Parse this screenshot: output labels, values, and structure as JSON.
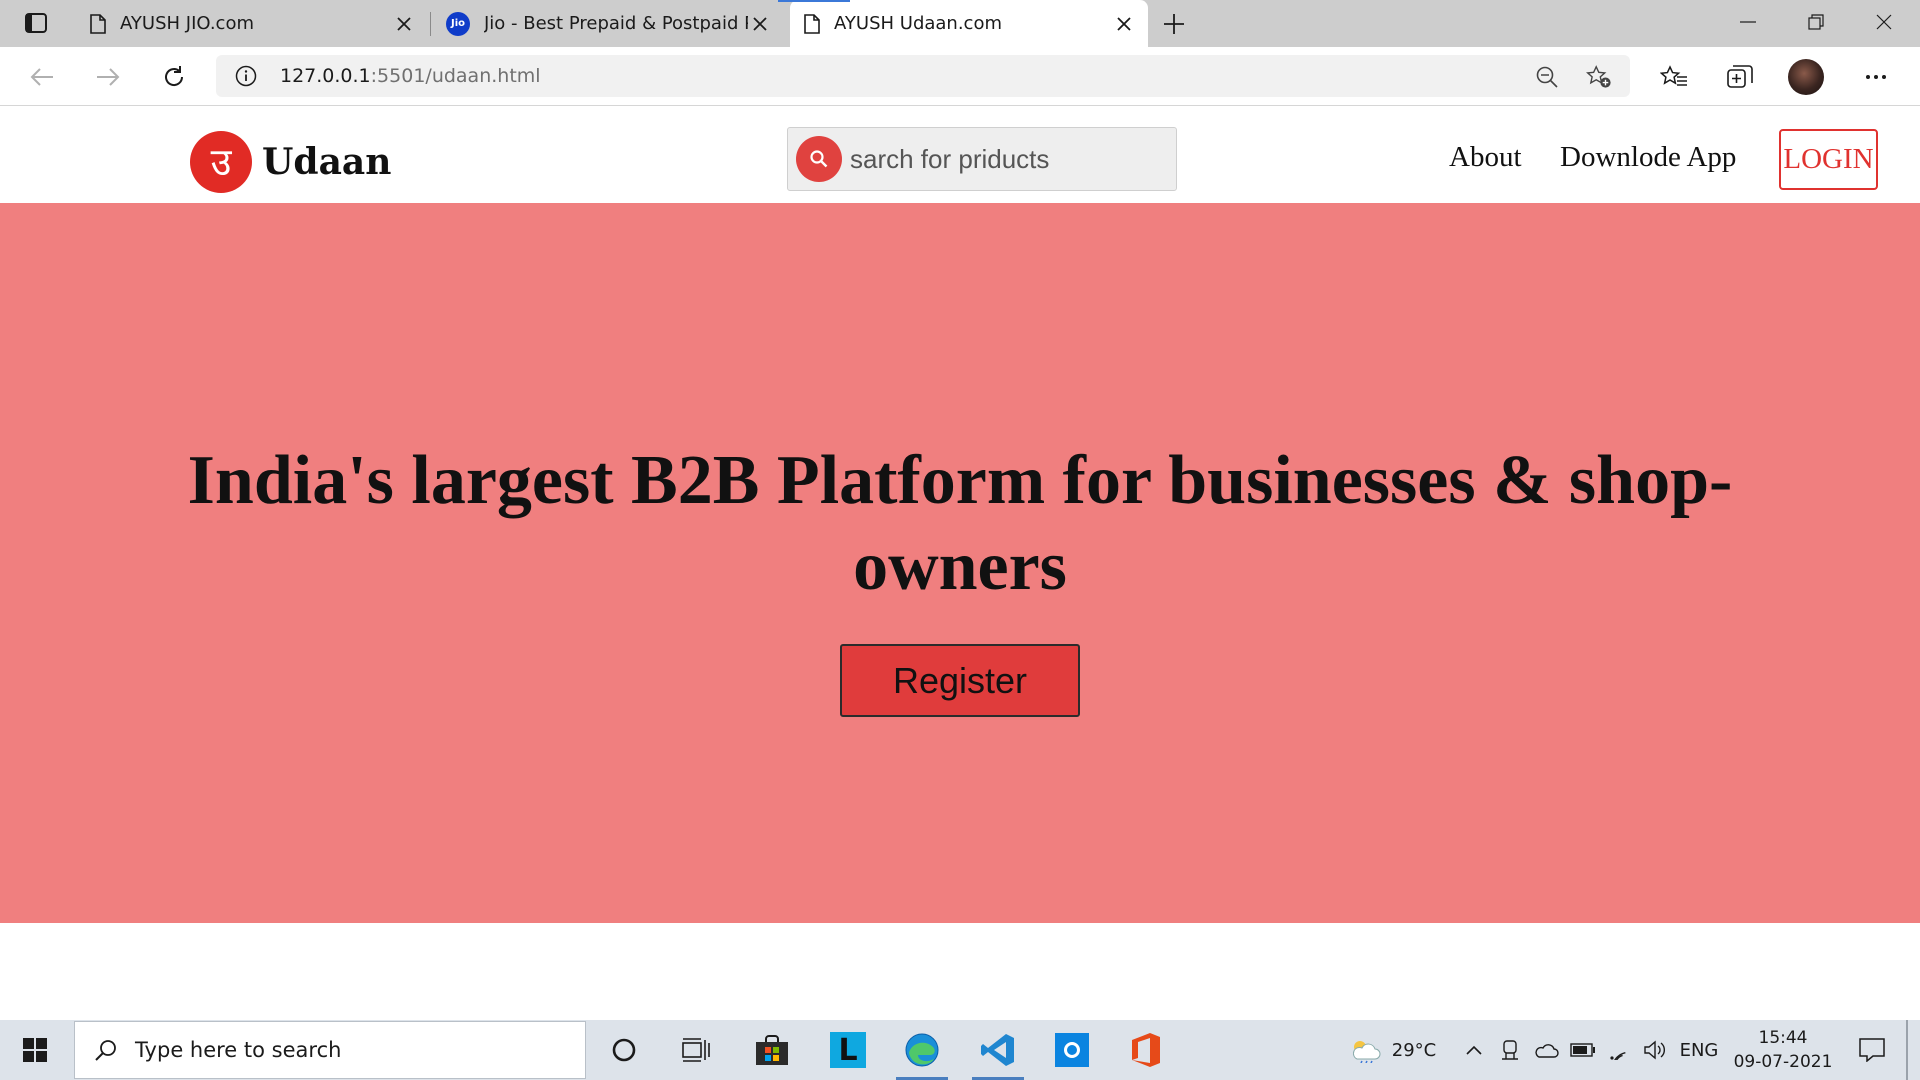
{
  "browser": {
    "tabs": [
      {
        "title": "AYUSH JIO.com",
        "icon": "page-icon"
      },
      {
        "title": "Jio - Best Prepaid & Postpaid Pla",
        "icon": "jio-favicon",
        "icon_text": "Jio"
      },
      {
        "title": "AYUSH Udaan.com",
        "icon": "page-icon",
        "active": true
      }
    ],
    "url_host": "127.0.0.1",
    "url_rest": ":5501/udaan.html",
    "accent": "#f07f7f"
  },
  "site": {
    "logo_text": "Udaan",
    "logo_glyph": "उ",
    "search_placeholder": "sarch for priducts",
    "nav": {
      "about": "About",
      "download": "Downlode App",
      "login": "LOGIN"
    },
    "hero_title": "India's largest B2B Platform for businesses & shop-owners",
    "register_label": "Register",
    "colors": {
      "hero_bg": "#f07f7f",
      "brand_red": "#e12b25",
      "button_red": "#e03c3c"
    }
  },
  "taskbar": {
    "search_placeholder": "Type here to search",
    "weather": "29°C",
    "language": "ENG",
    "time": "15:44",
    "date": "09-07-2021"
  }
}
